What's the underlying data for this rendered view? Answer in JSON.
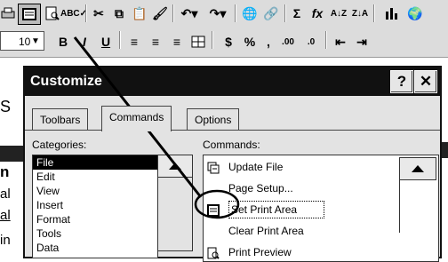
{
  "toolbar_standard": {
    "buttons": [
      "print-icon",
      "print-area-icon",
      "print-preview-icon",
      "spelling-icon",
      "cut-icon",
      "copy-icon",
      "paste-icon",
      "format-painter-icon",
      "undo-icon",
      "redo-icon",
      "hyperlink-icon",
      "web-icon",
      "autosum-icon",
      "function-icon",
      "sort-ascending-icon",
      "sort-descending-icon",
      "chart-wizard-icon",
      "map-icon"
    ],
    "autosum_label": "Σ",
    "function_label": "fx"
  },
  "toolbar_formatting": {
    "font_size": "10",
    "bold_label": "B",
    "italic_label": "I",
    "underline_label": "U",
    "currency_label": "$",
    "percent_label": "%",
    "comma_label": ",",
    "increase_decimal_label": ".00",
    "decrease_decimal_label": ".0"
  },
  "background_sheet": {
    "fragments": [
      "S",
      "n",
      "al",
      "al",
      "in"
    ]
  },
  "dialog": {
    "title": "Customize",
    "help_label": "?",
    "close_label": "✕",
    "tabs": [
      {
        "label": "Toolbars",
        "active": false
      },
      {
        "label": "Commands",
        "active": true
      },
      {
        "label": "Options",
        "active": false
      }
    ],
    "categories_label": "Categories:",
    "categories": [
      "File",
      "Edit",
      "View",
      "Insert",
      "Format",
      "Tools",
      "Data"
    ],
    "selected_category": "File",
    "commands_label": "Commands:",
    "commands": [
      {
        "label": "Update File",
        "icon": "update-file-icon"
      },
      {
        "label": "Page Setup...",
        "icon": ""
      },
      {
        "label": "Set Print Area",
        "icon": "set-print-area-icon"
      },
      {
        "label": "Clear Print Area",
        "icon": ""
      },
      {
        "label": "Print Preview",
        "icon": "print-preview-icon"
      }
    ],
    "selected_command": "Set Print Area"
  }
}
